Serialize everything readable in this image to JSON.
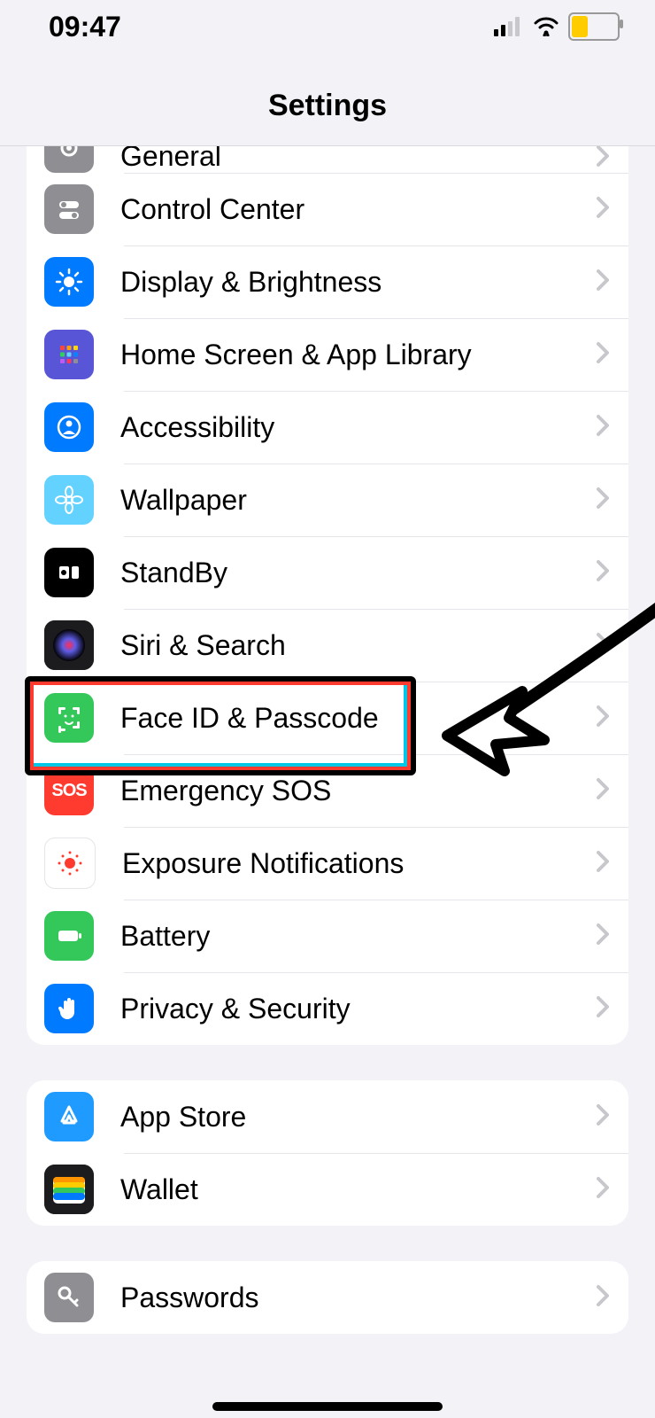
{
  "status": {
    "time": "09:47"
  },
  "title": "Settings",
  "groups": [
    {
      "first": true,
      "rows": [
        {
          "name": "general",
          "label": "General",
          "icon": "gear",
          "bg": "#8e8e93",
          "cut": true
        },
        {
          "name": "control-center",
          "label": "Control Center",
          "icon": "toggles",
          "bg": "#8e8e93"
        },
        {
          "name": "display-brightness",
          "label": "Display & Brightness",
          "icon": "sun",
          "bg": "#007aff"
        },
        {
          "name": "home-screen",
          "label": "Home Screen & App Library",
          "icon": "grid",
          "bg": "#5856d6"
        },
        {
          "name": "accessibility",
          "label": "Accessibility",
          "icon": "person",
          "bg": "#007aff"
        },
        {
          "name": "wallpaper",
          "label": "Wallpaper",
          "icon": "flower",
          "bg": "#64d2ff"
        },
        {
          "name": "standby",
          "label": "StandBy",
          "icon": "standby",
          "bg": "#000000"
        },
        {
          "name": "siri-search",
          "label": "Siri & Search",
          "icon": "siri",
          "bg": "#1c1c1e"
        },
        {
          "name": "face-id",
          "label": "Face ID & Passcode",
          "icon": "face",
          "bg": "#34c759",
          "highlighted": true
        },
        {
          "name": "emergency-sos",
          "label": "Emergency SOS",
          "icon": "sos",
          "bg": "#ff3b30"
        },
        {
          "name": "exposure",
          "label": "Exposure Notifications",
          "icon": "exposure",
          "bg": "#ffffff"
        },
        {
          "name": "battery",
          "label": "Battery",
          "icon": "battery",
          "bg": "#34c759"
        },
        {
          "name": "privacy",
          "label": "Privacy & Security",
          "icon": "hand",
          "bg": "#007aff"
        }
      ]
    },
    {
      "rows": [
        {
          "name": "app-store",
          "label": "App Store",
          "icon": "appstore",
          "bg": "#1f9bff"
        },
        {
          "name": "wallet",
          "label": "Wallet",
          "icon": "wallet",
          "bg": "#1c1c1e"
        }
      ]
    },
    {
      "rows": [
        {
          "name": "passwords",
          "label": "Passwords",
          "icon": "key",
          "bg": "#8e8e93"
        }
      ]
    }
  ]
}
